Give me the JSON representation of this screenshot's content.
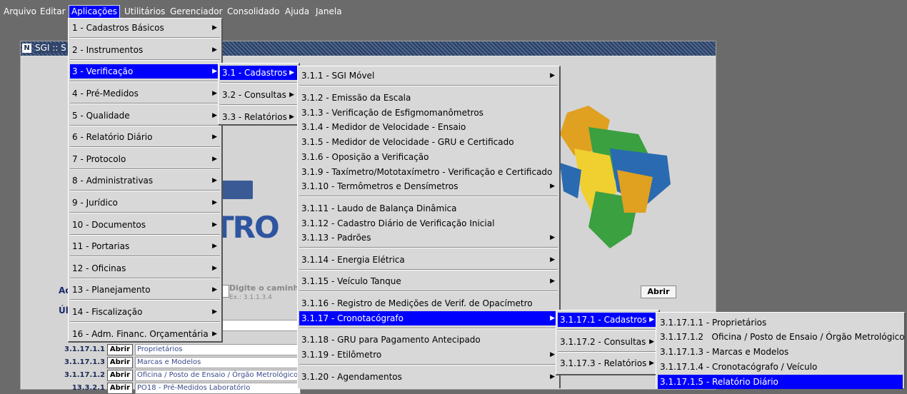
{
  "menubar": [
    "Arquivo",
    "Editar",
    "Aplicações",
    "Utilitários",
    "Gerenciador",
    "Consolidado",
    "Ajuda",
    "Janela"
  ],
  "window": {
    "icon": "N",
    "title": "SGI :: S"
  },
  "logo_text": "TRO",
  "labels": {
    "acesso": "Ac",
    "ultimos": "Últ",
    "hint_title": "Digite o caminho",
    "hint_example": "Ex.: 3.1.1.3.4",
    "abrir": "Abrir"
  },
  "history": [
    {
      "code": "3.1.17.1.1",
      "button": "Abrir",
      "desc": "Proprietários"
    },
    {
      "code": "3.1.17.1.3",
      "button": "Abrir",
      "desc": "Marcas e Modelos"
    },
    {
      "code": "3.1.17.1.2",
      "button": "Abrir",
      "desc": "Oficina / Posto de Ensaio / Órgão Metrológico"
    },
    {
      "code": "13.3.2.1",
      "button": "Abrir",
      "desc": "PO18 - Pré-Medidos Laboratório"
    }
  ],
  "menu_aplicacoes": [
    "1 - Cadastros Básicos",
    "2 - Instrumentos",
    "3 - Verificação",
    "4 - Pré-Medidos",
    "5 - Qualidade",
    "6 - Relatório Diário",
    "7 - Protocolo",
    "8 - Administrativas",
    "9 - Jurídico",
    "10 - Documentos",
    "11 - Portarias",
    "12 - Oficinas",
    "13 - Planejamento",
    "14 - Fiscalização",
    "16 - Adm. Financ. Orçamentária"
  ],
  "menu_verificacao": [
    "3.1 - Cadastros",
    "3.2 - Consultas",
    "3.3 - Relatórios"
  ],
  "menu_cadastros": [
    "3.1.1 - SGI Móvel",
    "3.1.2 - Emissão da Escala",
    "3.1.3 - Verificação de Esfigmomanômetros",
    "3.1.4 - Medidor de Velocidade - Ensaio",
    "3.1.5 - Medidor de Velocidade - GRU e Certificado",
    "3.1.6 - Oposição a Verificação",
    "3.1.9 - Taxímetro/Mototaxímetro - Verificação e Certificado",
    "3.1.10 - Termômetros e Densímetros",
    "3.1.11 - Laudo de Balança Dinâmica",
    "3.1.12 - Cadastro Diário de Verificação Inicial",
    "3.1.13 - Padrões",
    "3.1.14 - Energia Elétrica",
    "3.1.15 - Veículo Tanque",
    "3.1.16 - Registro de Medições de Verif. de Opacímetro",
    "3.1.17 - Cronotacógrafo",
    "3.1.18 - GRU para Pagamento Antecipado",
    "3.1.19 - Etilômetro",
    "3.1.20 - Agendamentos"
  ],
  "menu_cronotacografo": [
    "3.1.17.1 - Cadastros",
    "3.1.17.2 - Consultas",
    "3.1.17.3 - Relatórios"
  ],
  "menu_crono_cadastros": [
    "3.1.17.1.1 - Proprietários",
    "3.1.17.1.2   Oficina / Posto de Ensaio / Órgão Metrológico",
    "3.1.17.1.3 - Marcas e Modelos",
    "3.1.17.1.4 - Cronotacógrafo / Veículo",
    "3.1.17.1.5 - Relatório Diário"
  ]
}
